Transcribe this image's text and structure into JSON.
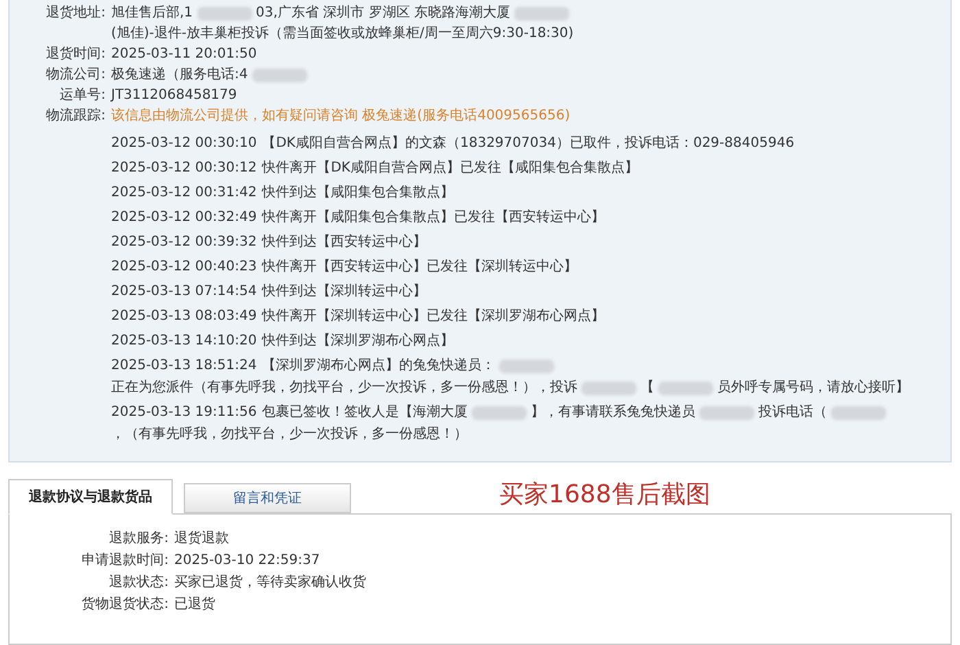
{
  "return_info": [
    {
      "label": "退货地址:",
      "parts": [
        {
          "kind": "text",
          "text": "旭佳售后部,1"
        },
        {
          "kind": "redacted"
        },
        {
          "kind": "text",
          "text": "03,广东省 深圳市 罗湖区 东晓路海潮大厦"
        },
        {
          "kind": "redacted"
        },
        {
          "kind": "text",
          "text": "(旭佳)-退件-放丰巢柜投诉（需当面签收或放蜂巢柜/周一至周六9:30-18:30)"
        }
      ]
    },
    {
      "label": "退货时间:",
      "parts": [
        {
          "kind": "text",
          "text": "2025-03-11 20:01:50"
        }
      ]
    },
    {
      "label": "物流公司:",
      "parts": [
        {
          "kind": "text",
          "text": "极兔速递（服务电话:4"
        },
        {
          "kind": "redacted"
        }
      ]
    },
    {
      "label": "运单号:",
      "parts": [
        {
          "kind": "text",
          "text": "JT3112068458179"
        }
      ]
    },
    {
      "label": "物流跟踪:",
      "kind": "notice",
      "parts": [
        {
          "kind": "text",
          "text": "该信息由物流公司提供，如有疑问请咨询 极兔速递(服务电话4009565656)"
        }
      ]
    }
  ],
  "tracking": [
    {
      "time": "2025-03-12 00:30:10",
      "parts": [
        {
          "kind": "text",
          "text": "【DK咸阳自营合网点】的文森（18329707034）已取件，投诉电话：029-88405946"
        }
      ]
    },
    {
      "time": "2025-03-12 00:30:12",
      "parts": [
        {
          "kind": "text",
          "text": "快件离开【DK咸阳自营合网点】已发往【咸阳集包合集散点】"
        }
      ]
    },
    {
      "time": "2025-03-12 00:31:42",
      "parts": [
        {
          "kind": "text",
          "text": "快件到达【咸阳集包合集散点】"
        }
      ]
    },
    {
      "time": "2025-03-12 00:32:49",
      "parts": [
        {
          "kind": "text",
          "text": "快件离开【咸阳集包合集散点】已发往【西安转运中心】"
        }
      ]
    },
    {
      "time": "2025-03-12 00:39:32",
      "parts": [
        {
          "kind": "text",
          "text": "快件到达【西安转运中心】"
        }
      ]
    },
    {
      "time": "2025-03-12 00:40:23",
      "parts": [
        {
          "kind": "text",
          "text": "快件离开【西安转运中心】已发往【深圳转运中心】"
        }
      ]
    },
    {
      "time": "2025-03-13 07:14:54",
      "parts": [
        {
          "kind": "text",
          "text": "快件到达【深圳转运中心】"
        }
      ]
    },
    {
      "time": "2025-03-13 08:03:49",
      "parts": [
        {
          "kind": "text",
          "text": "快件离开【深圳转运中心】已发往【深圳罗湖布心网点】"
        }
      ]
    },
    {
      "time": "2025-03-13 14:10:20",
      "parts": [
        {
          "kind": "text",
          "text": "快件到达【深圳罗湖布心网点】"
        }
      ]
    },
    {
      "time": "2025-03-13 18:51:24",
      "parts": [
        {
          "kind": "text",
          "text": "【深圳罗湖布心网点】的兔兔快递员："
        },
        {
          "kind": "redacted"
        },
        {
          "kind": "text",
          "text": "正在为您派件（有事先呼我，勿找平台，少一次投诉，多一份感恩！），投诉"
        },
        {
          "kind": "redacted"
        },
        {
          "kind": "text",
          "text": "【"
        },
        {
          "kind": "redacted"
        },
        {
          "kind": "text",
          "text": "员外呼专属号码，请放心接听】"
        }
      ]
    },
    {
      "time": "2025-03-13 19:11:56",
      "parts": [
        {
          "kind": "text",
          "text": "包裹已签收！签收人是【海潮大厦"
        },
        {
          "kind": "redacted"
        },
        {
          "kind": "text",
          "text": "】，有事请联系兔兔快递员"
        },
        {
          "kind": "redacted"
        },
        {
          "kind": "text",
          "text": "投诉电话（"
        },
        {
          "kind": "redacted"
        },
        {
          "kind": "text",
          "text": "，（有事先呼我，勿找平台，少一次投诉，多一份感恩！）"
        }
      ]
    }
  ],
  "tabs": [
    {
      "label": "退款协议与退款货品",
      "selected": true
    },
    {
      "label": "留言和凭证",
      "selected": false
    }
  ],
  "caption": "买家1688售后截图",
  "refund_details": [
    {
      "label": "退款服务:",
      "value": "退货退款"
    },
    {
      "label": "申请退款时间:",
      "value": "2025-03-10 22:59:37"
    },
    {
      "label": "退款状态:",
      "value": "买家已退货，等待卖家确认收货"
    },
    {
      "label": "货物退货状态:",
      "value": "已退货"
    }
  ]
}
